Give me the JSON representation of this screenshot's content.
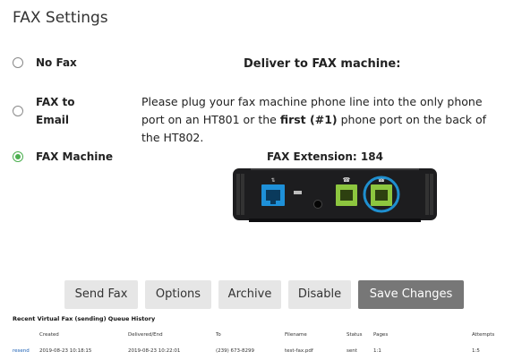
{
  "page": {
    "title": "FAX Settings"
  },
  "options": [
    {
      "label": "No Fax",
      "checked": false
    },
    {
      "label": "FAX to\nEmail",
      "checked": false
    },
    {
      "label": "FAX Machine",
      "checked": true
    }
  ],
  "machine": {
    "heading": "Deliver to FAX machine:",
    "instr_1": "Please plug your fax machine phone line into the only phone port on an HT801 or the ",
    "instr_bold": "first (#1)",
    "instr_2": " phone port on the back of the HT802.",
    "extension": "FAX Extension: 184"
  },
  "buttons": {
    "send_fax": "Send Fax",
    "options": "Options",
    "archive": "Archive",
    "disable": "Disable",
    "save": "Save Changes"
  },
  "queue": {
    "title": "Recent Virtual Fax (sending) Queue History",
    "columns": [
      "",
      "Created",
      "Delivered/End",
      "To",
      "Filename",
      "Status",
      "Pages",
      "Attempts"
    ],
    "rows": [
      {
        "action": "resend",
        "created": "2019-08-23 10:18:15",
        "delivered": "2019-08-23 10:22:01",
        "to": "(239) 673-8299",
        "filename": "test-fax.pdf",
        "status": "sent",
        "pages": "1:1",
        "attempts": "1:5"
      }
    ]
  },
  "colors": {
    "radio_checked": "#4caf50",
    "primary_button": "#777777",
    "port_highlight": "#1f8fcf",
    "ethernet_port": "#1e90d8",
    "phone_port": "#8dc63f"
  }
}
